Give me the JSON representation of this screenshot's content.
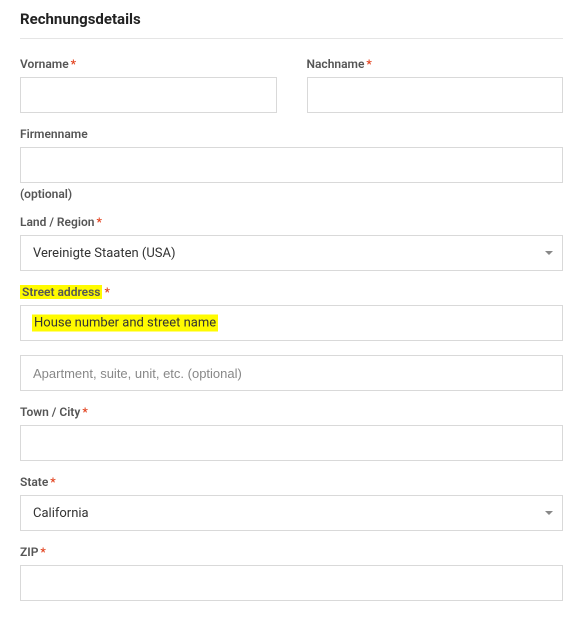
{
  "heading": "Rechnungsdetails",
  "fields": {
    "first_name": {
      "label": "Vorname",
      "value": ""
    },
    "last_name": {
      "label": "Nachname",
      "value": ""
    },
    "company": {
      "label": "Firmenname",
      "value": "",
      "optional_note": "(optional)"
    },
    "country": {
      "label": "Land / Region",
      "selected": "Vereinigte Staaten (USA)"
    },
    "street": {
      "label": "Street address",
      "line1_placeholder": "House number and street name",
      "line2_placeholder": "Apartment, suite, unit, etc. (optional)"
    },
    "city": {
      "label": "Town / City",
      "value": ""
    },
    "state": {
      "label": "State",
      "selected": "California"
    },
    "zip": {
      "label": "ZIP",
      "value": ""
    }
  },
  "required_marker": "*"
}
